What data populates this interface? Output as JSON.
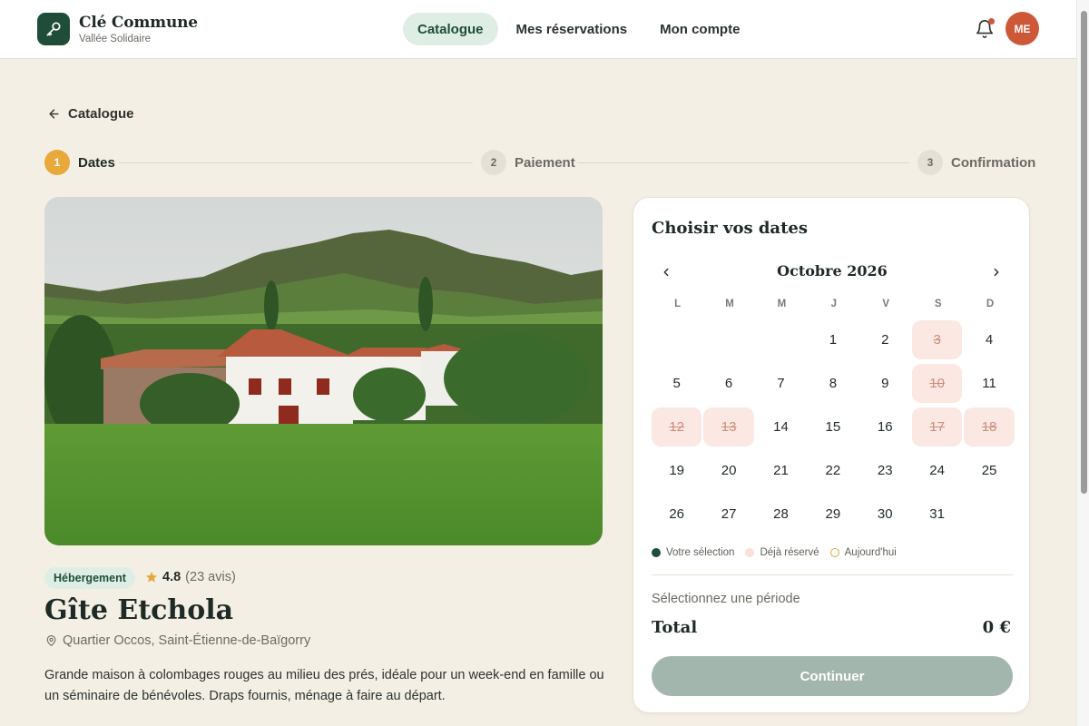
{
  "brand": {
    "name": "Clé Commune",
    "subtitle": "Vallée Solidaire"
  },
  "nav": [
    {
      "label": "Catalogue",
      "active": true
    },
    {
      "label": "Mes réservations",
      "active": false
    },
    {
      "label": "Mon compte",
      "active": false
    }
  ],
  "user": {
    "initials": "ME"
  },
  "back": {
    "label": "Catalogue"
  },
  "steps": [
    {
      "num": "1",
      "label": "Dates",
      "active": true
    },
    {
      "num": "2",
      "label": "Paiement",
      "active": false
    },
    {
      "num": "3",
      "label": "Confirmation",
      "active": false
    }
  ],
  "listing": {
    "tag": "Hébergement",
    "rating": "4.8",
    "reviews": "(23 avis)",
    "title": "Gîte Etchola",
    "location": "Quartier Occos, Saint-Étienne-de-Baïgorry",
    "description": "Grande maison à colombages rouges au milieu des prés, idéale pour un week-end en famille ou un séminaire de bénévoles. Draps fournis, ménage à faire au départ."
  },
  "calendar": {
    "title": "Choisir vos dates",
    "month": "Octobre 2026",
    "weekdays": [
      "L",
      "M",
      "M",
      "J",
      "V",
      "S",
      "D"
    ],
    "leading_blanks": 3,
    "days_in_month": 31,
    "booked_days": [
      3,
      10,
      12,
      13,
      17,
      18
    ],
    "legend": {
      "selection": "Votre sélection",
      "booked": "Déjà réservé",
      "today": "Aujourd'hui"
    }
  },
  "summary": {
    "period": "Sélectionnez une période",
    "total_label": "Total",
    "total_value": "0 €",
    "continue_label": "Continuer"
  },
  "colors": {
    "accent": "#1f4d3a",
    "step_active": "#e8a83a",
    "avatar": "#cd5838",
    "booked_bg": "#fbe8e2"
  }
}
